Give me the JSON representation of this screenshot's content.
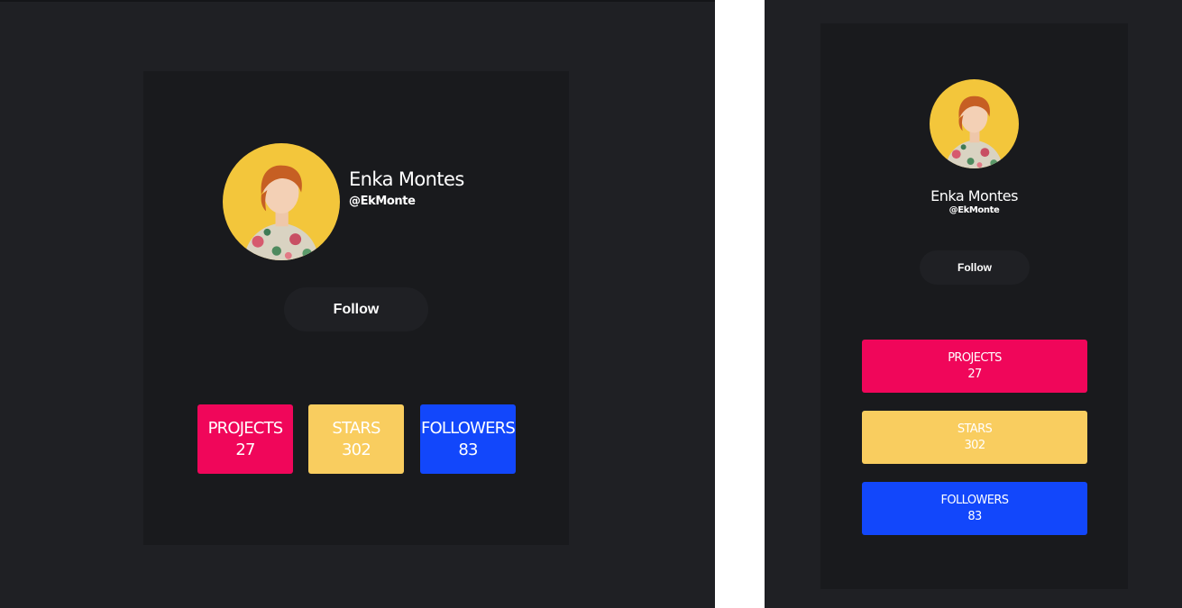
{
  "profile": {
    "name": "Enka Montes",
    "handle": "@EkMonte",
    "follow_label": "Follow"
  },
  "stats": [
    {
      "label": "PROJECTS",
      "value": "27"
    },
    {
      "label": "STARS",
      "value": "302"
    },
    {
      "label": "FOLLOWERS",
      "value": "83"
    }
  ],
  "colors": {
    "background": "#1f2024",
    "card": "#191a1d",
    "projects": "#f0065a",
    "stars": "#f9cd5f",
    "followers": "#1247fb",
    "avatar_bg": "#f3c63b"
  },
  "icons": {
    "avatar": "person-portrait-icon"
  }
}
